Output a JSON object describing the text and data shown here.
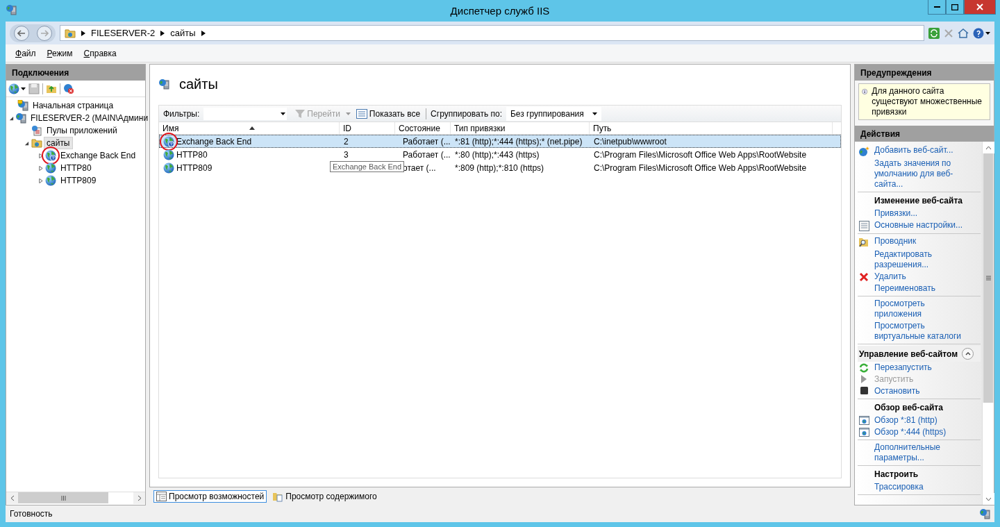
{
  "window": {
    "title": "Диспетчер служб IIS"
  },
  "address": {
    "segments": [
      "FILESERVER-2",
      "сайты"
    ]
  },
  "menu": [
    "Файл",
    "Режим",
    "Справка"
  ],
  "connections": {
    "title": "Подключения",
    "tree": [
      {
        "label": "Начальная страница",
        "kind": "home",
        "selected": false
      },
      {
        "label": "FILESERVER-2 (MAIN\\Админи",
        "kind": "server",
        "selected": false,
        "expanded": true,
        "children": [
          {
            "label": "Пулы приложений",
            "kind": "pools",
            "selected": false
          },
          {
            "label": "сайты",
            "kind": "folder",
            "selected": true,
            "expanded": true,
            "children": [
              {
                "label": "Exchange Back End",
                "kind": "site",
                "warning": true,
                "circled": true,
                "selected": false,
                "expanded": false
              },
              {
                "label": "HTTP80",
                "kind": "site",
                "warning": false,
                "circled": false,
                "selected": false,
                "expanded": false
              },
              {
                "label": "HTTP809",
                "kind": "site",
                "warning": false,
                "circled": false,
                "selected": false,
                "expanded": false
              }
            ]
          }
        ]
      }
    ]
  },
  "center": {
    "title": "сайты",
    "filter_label": "Фильтры:",
    "go": {
      "label": "Перейти",
      "disabled": true
    },
    "show_all": "Показать все",
    "group_label": "Сгруппировать по:",
    "group_value": "Без группирования",
    "columns": [
      {
        "label": "Имя",
        "sorted": true
      },
      {
        "label": "ID",
        "sorted": false
      },
      {
        "label": "Состояние",
        "sorted": false
      },
      {
        "label": "Тип привязки",
        "sorted": false
      },
      {
        "label": "Путь",
        "sorted": false
      }
    ],
    "rows": [
      {
        "name": "Exchange Back End",
        "id": "2",
        "state": "Работает (...",
        "binding": "*:81 (http);*:444 (https);* (net.pipe)",
        "path": "C:\\inetpub\\wwwroot",
        "selected": true,
        "warning": true,
        "circled": true
      },
      {
        "name": "HTTP80",
        "id": "3",
        "state": "Работает (...",
        "binding": "*:80 (http);*:443 (https)",
        "path": "C:\\Program Files\\Microsoft Office Web Apps\\RootWebsite",
        "selected": false,
        "warning": false,
        "circled": false
      },
      {
        "name": "HTTP809",
        "state": "отает (...",
        "binding": "*:809 (http);*:810 (https)",
        "path": "C:\\Program Files\\Microsoft Office Web Apps\\RootWebsite",
        "selected": false,
        "warning": false,
        "circled": false
      }
    ],
    "tooltip": "Exchange Back End"
  },
  "views": [
    {
      "label": "Просмотр возможностей",
      "selected": true,
      "kind": "features"
    },
    {
      "label": "Просмотр содержимого",
      "selected": false,
      "kind": "content"
    }
  ],
  "alerts": {
    "title": "Предупреждения",
    "message": "Для данного сайта существуют множественные привязки"
  },
  "actions": {
    "title": "Действия",
    "sections": [
      {
        "items": [
          {
            "label": "Добавить веб-сайт...",
            "kind": "add"
          },
          {
            "label": "Задать значения по умолчанию для веб-сайта..."
          }
        ]
      },
      {
        "title": "Изменение веб-сайта",
        "items": [
          {
            "label": "Привязки..."
          },
          {
            "label": "Основные настройки...",
            "kind": "settings"
          }
        ]
      },
      {
        "items": [
          {
            "label": "Проводник",
            "kind": "explorer"
          },
          {
            "label": "Редактировать разрешения..."
          },
          {
            "label": "Удалить",
            "kind": "delete"
          },
          {
            "label": "Переименовать"
          }
        ]
      },
      {
        "items": [
          {
            "label": "Просмотреть приложения"
          },
          {
            "label": "Просмотреть виртуальные каталоги"
          }
        ]
      },
      {
        "title": "Управление веб-сайтом",
        "collapsible": true,
        "expanded": true,
        "items": [
          {
            "label": "Перезапустить",
            "kind": "restart"
          },
          {
            "label": "Запустить",
            "kind": "start",
            "disabled": true
          },
          {
            "label": "Остановить",
            "kind": "stop"
          }
        ]
      },
      {
        "title": "Обзор веб-сайта",
        "items": [
          {
            "label": "Обзор *:81 (http)",
            "kind": "browse"
          },
          {
            "label": "Обзор *:444 (https)",
            "kind": "browse"
          }
        ]
      },
      {
        "items": [
          {
            "label": "Дополнительные параметры..."
          }
        ]
      },
      {
        "title": "Настроить",
        "items": [
          {
            "label": "Трассировка"
          }
        ]
      }
    ]
  },
  "status": "Готовность"
}
